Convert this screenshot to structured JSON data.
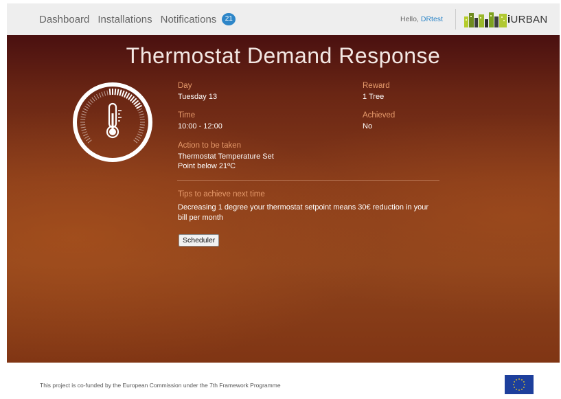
{
  "nav": {
    "items": [
      "Dashboard",
      "Installations",
      "Notifications"
    ],
    "notifications_count": "21"
  },
  "user": {
    "greeting": "Hello,",
    "name": "DRtest"
  },
  "brand": {
    "name_prefix": "i",
    "name_rest": "URBAN"
  },
  "page": {
    "title": "Thermostat Demand Response"
  },
  "details": {
    "day_label": "Day",
    "day_value": "Tuesday 13",
    "time_label": "Time",
    "time_value": "10:00 - 12:00",
    "action_label": "Action to be taken",
    "action_line1": "Thermostat Temperature Set",
    "action_line2": "Point below 21ºC",
    "reward_label": "Reward",
    "reward_value": "1 Tree",
    "achieved_label": "Achieved",
    "achieved_value": "No"
  },
  "tips": {
    "label": "Tips to achieve next time",
    "text": "Decreasing 1 degree your thermostat setpoint means 30€ reduction in your bill per month"
  },
  "buttons": {
    "scheduler": "Scheduler"
  },
  "footer": {
    "text": "This project is co-funded by the European Commission under the 7th Framework Programme"
  },
  "colors": {
    "accent_blue": "#2e86c8",
    "label_orange": "#e69a6b",
    "hero_dark": "#4a1010",
    "hero_mid": "#853a1a"
  },
  "icons": [
    "thermometer-icon",
    "thermostat-gauge",
    "skyline-logo-icon",
    "eu-flag-icon"
  ]
}
